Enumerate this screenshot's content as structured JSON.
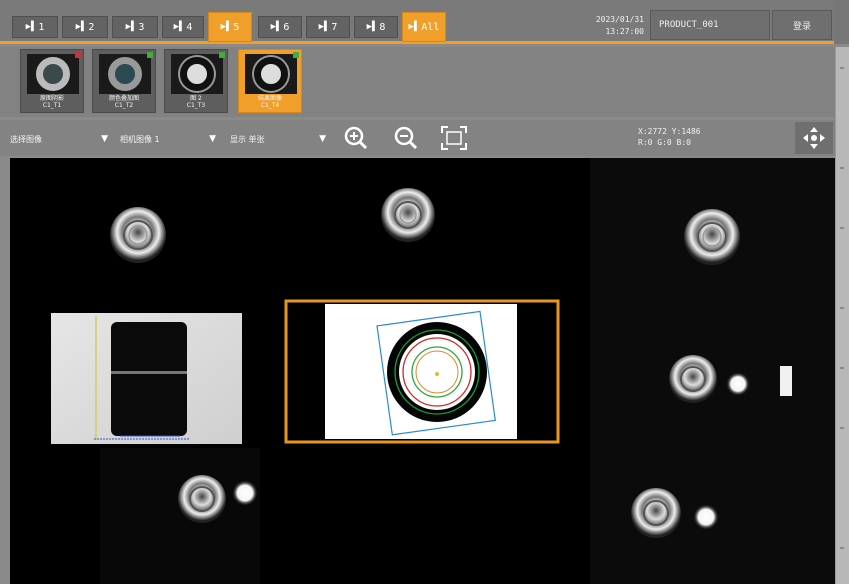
{
  "tabs": [
    {
      "label": "1",
      "active": false
    },
    {
      "label": "2",
      "active": false
    },
    {
      "label": "3",
      "active": false
    },
    {
      "label": "4",
      "active": false
    },
    {
      "label": "5",
      "active": true
    },
    {
      "label": "6",
      "active": false
    },
    {
      "label": "7",
      "active": false
    },
    {
      "label": "8",
      "active": false
    },
    {
      "label": "All",
      "active": true
    }
  ],
  "header": {
    "date": "2023/01/31",
    "time": "13:27:00",
    "product": "PRODUCT_001",
    "login_label": "登录"
  },
  "thumbnails": [
    {
      "label_line1": "原图阴影",
      "label_line2": "C1_T1",
      "flag_color": "#cc3333",
      "active": false
    },
    {
      "label_line1": "颜色叠加图",
      "label_line2": "C1_T2",
      "flag_color": "#44aa44",
      "active": false
    },
    {
      "label_line1": "图 2",
      "label_line2": "C1_T3",
      "flag_color": "#44aa44",
      "active": false
    },
    {
      "label_line1": "结果图像",
      "label_line2": "C1_T4",
      "flag_color": "#44aa44",
      "active": true
    }
  ],
  "toolbar": {
    "dropdown1": "选择图像",
    "dropdown2": "相机图像 1",
    "dropdown3": "显示 单张",
    "zoom_in_icon": "zoom-in-icon",
    "zoom_out_icon": "zoom-out-icon",
    "fit_icon": "fit-screen-icon",
    "coord_xy": "X:2772  Y:1486",
    "coord_rgb": "R:0 G:0 B:0",
    "move_icon": "move-arrows-icon"
  },
  "colors": {
    "accent": "#f0a02a",
    "panel": "#838383",
    "viewer_bg": "#000000"
  }
}
